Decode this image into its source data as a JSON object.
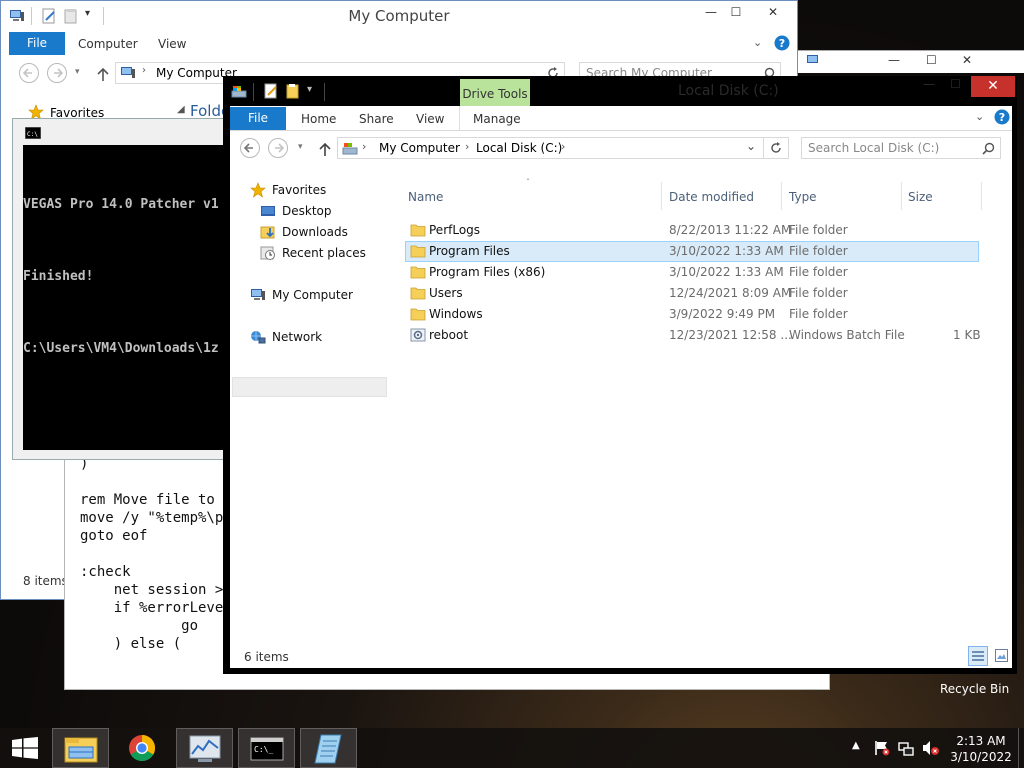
{
  "back_window": {
    "title": "My Computer",
    "tabs": {
      "file": "File",
      "computer": "Computer",
      "view": "View"
    },
    "address": "My Computer",
    "search_placeholder": "Search My Computer",
    "nav_favorites": "Favorites",
    "folders_label": "Folde",
    "status": "8 items",
    "caption": {
      "minimize": "—",
      "maximize": "☐",
      "close": "✕"
    }
  },
  "cmd_window": {
    "lines": [
      "VEGAS Pro 14.0 Patcher v1",
      "Finished!",
      "C:\\Users\\VM4\\Downloads\\1z"
    ]
  },
  "notepad_window": {
    "text": ")\n\nrem Move file to o\nmove /y \"%temp%\\pr\ngoto eof\n\n:check\n    net session >n\n    if %errorLevel\n            go\n    ) else ("
  },
  "front_window": {
    "title": "Local Disk (C:)",
    "contextual_tab": "Drive Tools",
    "tabs": {
      "file": "File",
      "home": "Home",
      "share": "Share",
      "view": "View",
      "manage": "Manage"
    },
    "breadcrumb": [
      "My Computer",
      "Local Disk (C:)"
    ],
    "search_placeholder": "Search Local Disk (C:)",
    "nav": {
      "favorites": "Favorites",
      "desktop": "Desktop",
      "downloads": "Downloads",
      "recent": "Recent places",
      "my_computer": "My Computer",
      "network": "Network"
    },
    "columns": {
      "name": "Name",
      "date": "Date modified",
      "type": "Type",
      "size": "Size"
    },
    "files": [
      {
        "name": "PerfLogs",
        "date": "8/22/2013 11:22 AM",
        "type": "File folder",
        "size": "",
        "icon": "folder-icon"
      },
      {
        "name": "Program Files",
        "date": "3/10/2022 1:33 AM",
        "type": "File folder",
        "size": "",
        "icon": "folder-icon"
      },
      {
        "name": "Program Files (x86)",
        "date": "3/10/2022 1:33 AM",
        "type": "File folder",
        "size": "",
        "icon": "folder-icon"
      },
      {
        "name": "Users",
        "date": "12/24/2021 8:09 AM",
        "type": "File folder",
        "size": "",
        "icon": "folder-icon"
      },
      {
        "name": "Windows",
        "date": "3/9/2022 9:49 PM",
        "type": "File folder",
        "size": "",
        "icon": "folder-icon"
      },
      {
        "name": "reboot",
        "date": "12/23/2021 12:58 ...",
        "type": "Windows Batch File",
        "size": "1 KB",
        "icon": "batch-file-icon"
      }
    ],
    "selected_index": 1,
    "status": "6 items",
    "caption": {
      "minimize": "—",
      "maximize": "☐",
      "close": "✕"
    }
  },
  "desktop": {
    "recycle_bin": "Recycle Bin"
  },
  "taskbar": {
    "time": "2:13 AM",
    "date": "3/10/2022",
    "apps": [
      "file-explorer-icon",
      "chrome-icon",
      "performance-monitor-icon",
      "command-prompt-icon",
      "notepad-icon"
    ]
  },
  "colors": {
    "accent": "#1979ca",
    "drive_tools": "#b9e39a",
    "close_red": "#c7312b",
    "selection": "#d9ebf9"
  }
}
